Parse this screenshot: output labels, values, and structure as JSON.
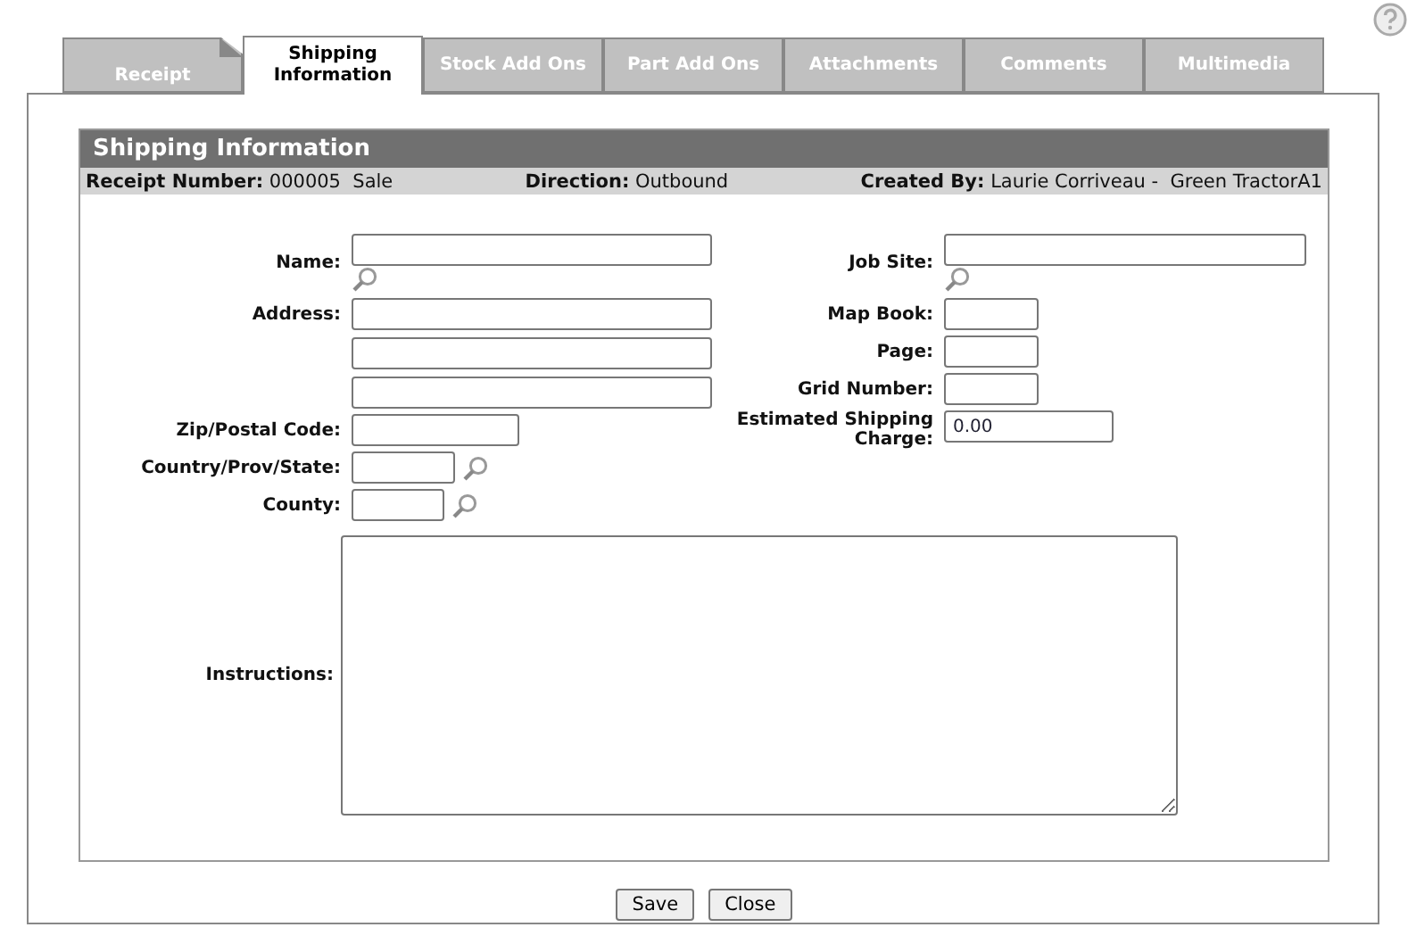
{
  "tabs": [
    {
      "label": "Receipt",
      "selected": false,
      "kind": "dogear"
    },
    {
      "label": "Shipping Information",
      "selected": true,
      "kind": "plain"
    },
    {
      "label": "Stock Add Ons",
      "selected": false,
      "kind": "plain"
    },
    {
      "label": "Part Add Ons",
      "selected": false,
      "kind": "plain"
    },
    {
      "label": "Attachments",
      "selected": false,
      "kind": "plain"
    },
    {
      "label": "Comments",
      "selected": false,
      "kind": "plain"
    },
    {
      "label": "Multimedia",
      "selected": false,
      "kind": "plain"
    }
  ],
  "section": {
    "title": "Shipping Information",
    "info": [
      {
        "label": "Receipt Number:",
        "value": "000005  Sale"
      },
      {
        "label": "Direction:",
        "value": "Outbound"
      },
      {
        "label": "Created By:",
        "value": "Laurie Corriveau -  Green TractorA1"
      }
    ]
  },
  "left_fields": [
    {
      "label": "Name:",
      "kind": "lookup-below",
      "inputs": [
        {
          "kind": "text"
        }
      ]
    },
    {
      "label": "Address:",
      "kind": "plain",
      "inputs": [
        {
          "kind": "text"
        },
        {
          "kind": "text"
        },
        {
          "kind": "text"
        }
      ]
    },
    {
      "label": "Zip/Postal Code:",
      "kind": "plain",
      "inputs": [
        {
          "kind": "text"
        }
      ]
    },
    {
      "label": "Country/Prov/State:",
      "kind": "lookup-beside",
      "inputs": [
        {
          "kind": "text"
        }
      ]
    },
    {
      "label": "County:",
      "kind": "lookup-beside",
      "inputs": [
        {
          "kind": "text"
        }
      ]
    }
  ],
  "right_fields": [
    {
      "label": "Job Site:",
      "kind": "lookup-below",
      "inputs": [
        {
          "kind": "text"
        }
      ]
    },
    {
      "label": "Map Book:",
      "kind": "plain",
      "inputs": [
        {
          "kind": "text"
        }
      ]
    },
    {
      "label": "Page:",
      "kind": "plain",
      "inputs": [
        {
          "kind": "text"
        }
      ]
    },
    {
      "label": "Grid Number:",
      "kind": "plain",
      "inputs": [
        {
          "kind": "text"
        }
      ]
    },
    {
      "label": "Estimated Shipping Charge:",
      "kind": "plain",
      "inputs": [
        {
          "kind": "text",
          "value": "0.00"
        }
      ]
    }
  ],
  "instructions": {
    "label": "Instructions:"
  },
  "buttons": [
    "Save",
    "Close"
  ]
}
